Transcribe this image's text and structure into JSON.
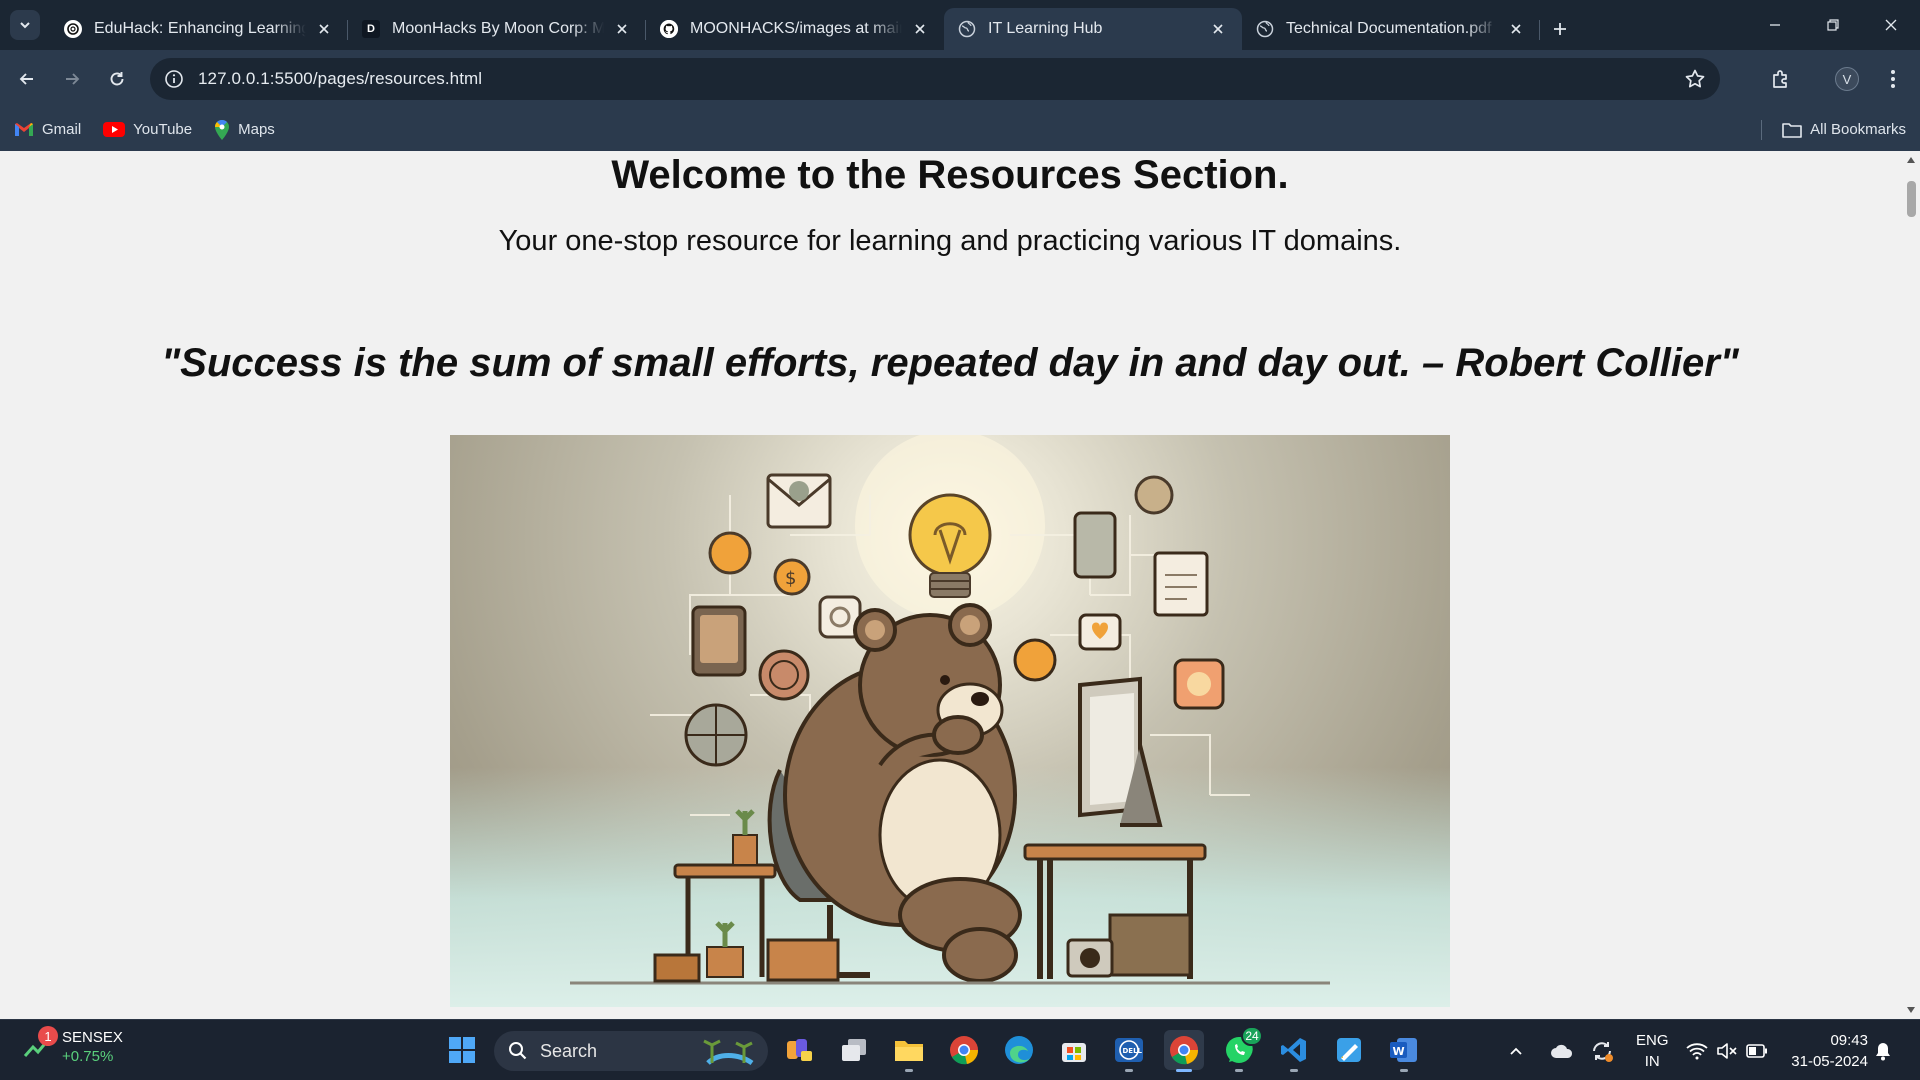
{
  "tabs": [
    {
      "title": "EduHack: Enhancing Learning E",
      "icon": "openai-icon"
    },
    {
      "title": "MoonHacks By Moon Corp: Mo",
      "icon": "letter-d-icon",
      "badge": "D"
    },
    {
      "title": "MOONHACKS/images at main ·",
      "icon": "github-icon"
    },
    {
      "title": "IT Learning Hub",
      "icon": "globe-icon",
      "active": true
    },
    {
      "title": "Technical Documentation.pdf",
      "icon": "globe-icon"
    }
  ],
  "toolbar": {
    "url": "127.0.0.1:5500/pages/resources.html",
    "profile_initial": "V"
  },
  "bookmarks": {
    "items": [
      {
        "label": "Gmail",
        "icon": "gmail-icon"
      },
      {
        "label": "YouTube",
        "icon": "youtube-icon"
      },
      {
        "label": "Maps",
        "icon": "maps-icon"
      }
    ],
    "all_label": "All Bookmarks"
  },
  "page": {
    "title": "Welcome to the Resources Section.",
    "subtitle": "Your one-stop resource for learning and practicing various IT domains.",
    "quote": "\"Success is the sum of small efforts, repeated day in and day out. – Robert Collier\"",
    "hero_image": "bear-at-desk-illustration"
  },
  "taskbar": {
    "widget_badge": "1",
    "widget_title": "SENSEX",
    "widget_value": "+0.75%",
    "search_label": "Search",
    "whatsapp_badge": "24",
    "lang_line1": "ENG",
    "lang_line2": "IN",
    "time": "09:43",
    "date": "31-05-2024"
  },
  "colors": {
    "tab_strip": "#1b2633",
    "toolbar": "#2b3a4d",
    "page_bg": "#f1f1f1",
    "taskbar": "#1b2330",
    "positive": "#5ad07c"
  }
}
